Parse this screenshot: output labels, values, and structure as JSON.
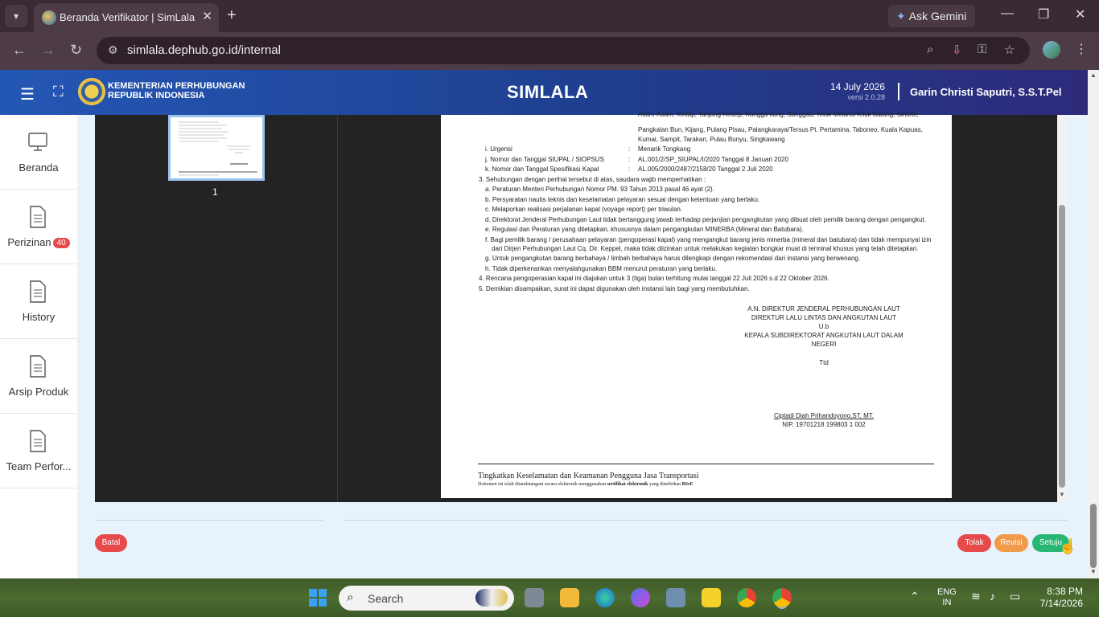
{
  "browser": {
    "tab_title": "Beranda Verifikator | SimLala",
    "new_tab": "+",
    "close_tab": "✕",
    "gemini": "Ask Gemini",
    "url": "simlala.dephub.go.id/internal"
  },
  "header": {
    "ministry_line1": "KEMENTERIAN PERHUBUNGAN",
    "ministry_line2": "REPUBLIK INDONESIA",
    "app_title": "SIMLALA",
    "date": "14 July 2026",
    "version": "versi 2.0.28",
    "user": "Garin Christi Saputri, S.S.T.Pel"
  },
  "sidebar": {
    "items": [
      {
        "label": "Beranda"
      },
      {
        "label": "Perizinan",
        "badge": "40"
      },
      {
        "label": "History"
      },
      {
        "label": "Arsip Produk"
      },
      {
        "label": "Team Perfor..."
      }
    ]
  },
  "viewer": {
    "page_number": "1",
    "doc": {
      "l0": "Asam-Asam, Kintap, Tanjung Redep, Rangga Ilung, Sanggau, Telok Melano/Teluk Batang, Sintete,",
      "l1": "Pangkalan Bun, Kijang, Pulang Pisau, Palangkaraya/Tersus Pt. Pertamina, Taboneo, Kuala Kapuas,",
      "l2": "Kumai, Sampit, Tarakan, Pulau Bunyu, Singkawang",
      "i_label": "i.  Urgensi",
      "i_val": "Menarik Tongkang",
      "j_label": "j.  Nomor dan Tanggal SIUPAL / SIOPSUS",
      "j_val": "AL.001/2/SP_SIUPAL/I/2020  Tanggal 8 Januari 2020",
      "k_label": "k.  Nomor dan Tanggal Spesifikasi Kapal",
      "k_val": "AL.005/2000/2487/2158/20  Tanggal 2 Juli 2020",
      "colon": ":",
      "p3": "3. Sehubungan dengan perihal tersebut di atas, saudara wajib memperhatikan :",
      "a": "a.  Peraturan Menteri Perhubungan Nomor PM. 93 Tahun 2013 pasal 46 ayat (2).",
      "b": "b.  Persyaratan nautis teknis dan keselamatan pelayaran sesuai dengan ketentuan yang berlaku.",
      "c": "c.  Melaporkan realisasi perjalanan kapal (voyage report) per triwulan.",
      "d": "d.  Direktorat Jenderal Perhubungan Laut tidak bertanggung jawab terhadap perjanjian pengangkutan yang dibuat oleh pemilik barang dengan pengangkut.",
      "e": "e.  Regulasi dan Peraturan yang ditetapkan, khususnya dalam pengangkutan MINERBA (Mineral dan Batubara).",
      "f1": "f.   Bagi pemilik barang / perusahaan pelayaran (pengoperasi kapal) yang mengangkut barang jenis minerba (mineral dan batubara) dan tidak mempunyai izin",
      "f2": "dari Dirjen Perhubungan Laut Cq. Dir. Keppel, maka tidak diizinkan untuk melakukan kegiatan bongkar muat di terminal khusus yang telah ditetapkan.",
      "g": "g.  Untuk pengangkutan barang berbahaya / limbah berbahaya harus dilengkapi dengan rekomendasi dari instansi yang berwenang.",
      "h": "h.  Tidak diperkenankan menyalahgunakan BBM menurut peraturan yang berlaku.",
      "p4": "4. Rencana pengoperasian kapal ini diajukan untuk 3 (tiga) bulan terhitung mulai tanggal 22 Juli 2026 s.d 22 Oktober 2026.",
      "p5": "5. Demikian disampaikan,  surat ini dapat  digunakan oleh instansi lain bagi yang membutuhkan.",
      "sig1": "A.N. DIREKTUR JENDERAL PERHUBUNGAN LAUT",
      "sig2": "DIREKTUR LALU LINTAS DAN ANGKUTAN LAUT",
      "sig3": "U.b",
      "sig4": "KEPALA SUBDIREKTORAT ANGKUTAN LAUT DALAM",
      "sig5": "NEGERI",
      "ttd": "Ttd",
      "signer": "Ciptadi Diah Prihandoyono,ST, MT.",
      "nip": "NIP. 19701218 199803 1 002",
      "footer_motto": "Tingkatkan Keselamatan dan Keamanan Pengguna Jasa Transportasi",
      "footer_note_a": "Dokumen ini telah ditandatangani secara elektronik menggunakan ",
      "footer_note_b": "sertifikat elektronik",
      "footer_note_c": " yang diterbitkan ",
      "footer_note_d": "BSrE"
    }
  },
  "actions": {
    "batal": "Batal",
    "tolak": "Tolak",
    "revisi": "Revisi",
    "setuju": "Setuju"
  },
  "taskbar": {
    "search": "Search",
    "lang1": "ENG",
    "lang2": "IN",
    "time": "8:38 PM",
    "date": "7/14/2026"
  }
}
